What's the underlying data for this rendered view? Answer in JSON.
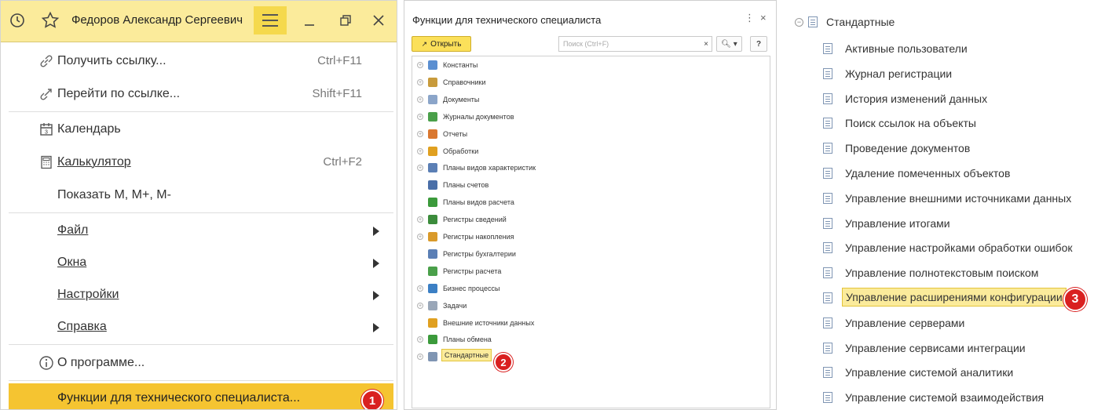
{
  "main_menu": {
    "user_name": "Федоров Александр Сергеевич",
    "items": [
      {
        "label": "Получить ссылку...",
        "shortcut": "Ctrl+F11",
        "icon": "link-icon"
      },
      {
        "label": "Перейти по ссылке...",
        "shortcut": "Shift+F11",
        "icon": "follow-link-icon"
      },
      {
        "label": "Календарь",
        "shortcut": "",
        "icon": "calendar-icon"
      },
      {
        "label": "Калькулятор",
        "shortcut": "Ctrl+F2",
        "icon": "calculator-icon"
      },
      {
        "label": "Показать M, M+, M-",
        "shortcut": "",
        "icon": ""
      },
      {
        "label": "Файл",
        "has_submenu": true
      },
      {
        "label": "Окна",
        "has_submenu": true
      },
      {
        "label": "Настройки",
        "has_submenu": true
      },
      {
        "label": "Справка",
        "has_submenu": true
      },
      {
        "label": "О программе...",
        "icon": "info-icon"
      },
      {
        "label": "Функции для технического специалиста..."
      }
    ],
    "calendar_day": "3",
    "step_badge": "1",
    "highlight_color": "#f5c431"
  },
  "tech_functions": {
    "title": "Функции для технического специалиста",
    "more_glyph": "⋮",
    "close_glyph": "×",
    "open_button": "Открыть",
    "search_placeholder": "Поиск (Ctrl+F)",
    "clear_glyph": "×",
    "search_glyph": "🔍︎ ▾",
    "help_glyph": "?",
    "tree": [
      {
        "label": "Константы",
        "expandable": true,
        "icon_color": "#5b8fd1"
      },
      {
        "label": "Справочники",
        "expandable": true,
        "icon_color": "#c89b3c"
      },
      {
        "label": "Документы",
        "expandable": true,
        "icon_color": "#8ba5c9"
      },
      {
        "label": "Журналы документов",
        "expandable": true,
        "icon_color": "#4aa04a"
      },
      {
        "label": "Отчеты",
        "expandable": true,
        "icon_color": "#d9772f"
      },
      {
        "label": "Обработки",
        "expandable": true,
        "icon_color": "#e0a020"
      },
      {
        "label": "Планы видов характеристик",
        "expandable": true,
        "icon_color": "#5b7fb5"
      },
      {
        "label": "Планы счетов",
        "expandable": false,
        "icon_color": "#4a6fa8"
      },
      {
        "label": "Планы видов расчета",
        "expandable": false,
        "icon_color": "#3b9a3b"
      },
      {
        "label": "Регистры сведений",
        "expandable": true,
        "icon_color": "#3c8c3c"
      },
      {
        "label": "Регистры накопления",
        "expandable": true,
        "icon_color": "#d99a2a"
      },
      {
        "label": "Регистры бухгалтерии",
        "expandable": false,
        "icon_color": "#5b7fb5"
      },
      {
        "label": "Регистры расчета",
        "expandable": false,
        "icon_color": "#4aa04a"
      },
      {
        "label": "Бизнес процессы",
        "expandable": true,
        "icon_color": "#3b7fc4"
      },
      {
        "label": "Задачи",
        "expandable": true,
        "icon_color": "#9aa7b8"
      },
      {
        "label": "Внешние источники данных",
        "expandable": false,
        "icon_color": "#e0a020"
      },
      {
        "label": "Планы обмена",
        "expandable": true,
        "icon_color": "#3b9a3b"
      },
      {
        "label": "Стандартные",
        "expandable": true,
        "icon_color": "#7f95b3",
        "selected": true
      }
    ],
    "step_badge": "2"
  },
  "standard": {
    "title": "Стандартные",
    "items": [
      "Активные пользователи",
      "Журнал регистрации",
      "История изменений данных",
      "Поиск ссылок на объекты",
      "Проведение документов",
      "Удаление помеченных объектов",
      "Управление внешними источниками данных",
      "Управление итогами",
      "Управление настройками обработки ошибок",
      "Управление полнотекстовым поиском",
      "Управление расширениями конфигурации",
      "Управление серверами",
      "Управление сервисами интеграции",
      "Управление системой аналитики",
      "Управление системой взаимодействия"
    ],
    "selected_index": 10,
    "step_badge": "3"
  }
}
